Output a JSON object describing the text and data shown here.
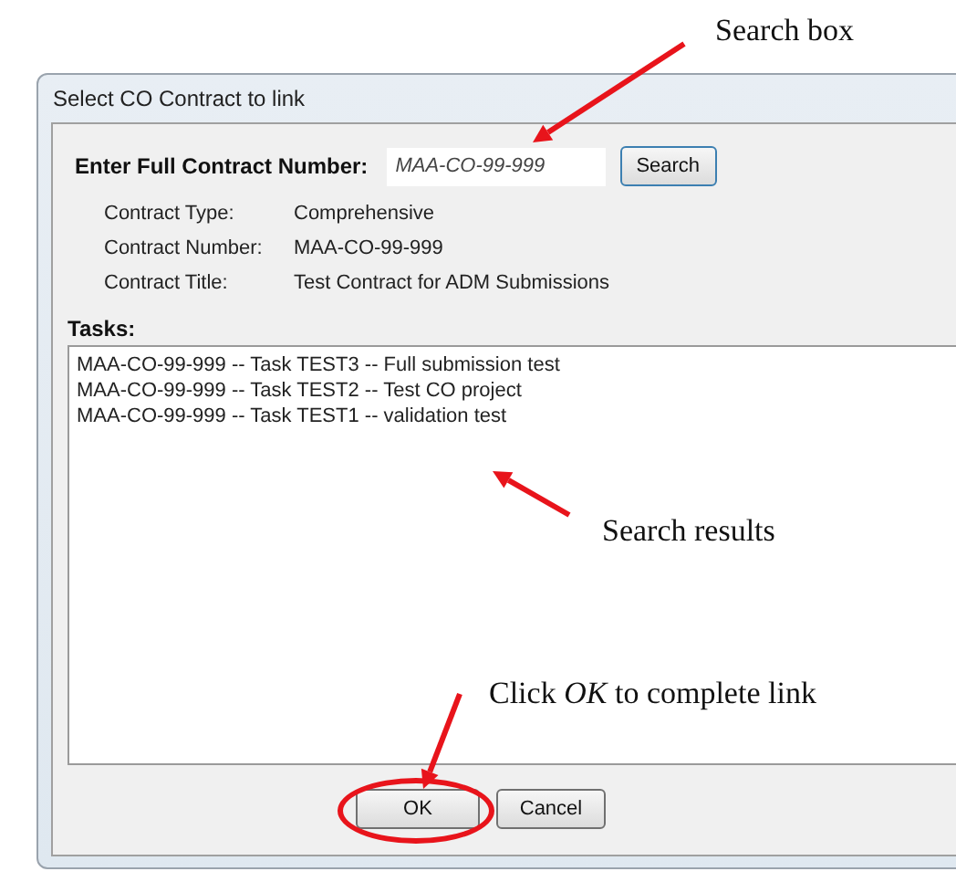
{
  "window": {
    "title": "Select CO Contract to link"
  },
  "search": {
    "label": "Enter Full Contract Number:",
    "value": "MAA-CO-99-999",
    "button": "Search"
  },
  "details": [
    {
      "label": "Contract Type:",
      "value": "Comprehensive"
    },
    {
      "label": "Contract Number:",
      "value": "MAA-CO-99-999"
    },
    {
      "label": "Contract Title:",
      "value": "Test Contract for ADM Submissions"
    }
  ],
  "tasks": {
    "label": "Tasks:",
    "items": [
      {
        "text": "MAA-CO-99-999 -- Task TEST3 -- Full submission test",
        "selected": false
      },
      {
        "text": "MAA-CO-99-999 -- Task TEST2 -- Test CO project",
        "selected": false
      },
      {
        "text": "MAA-CO-99-999 -- Task TEST1 -- validation test",
        "selected": false
      }
    ]
  },
  "buttons": [
    {
      "label": "OK",
      "circled": true
    },
    {
      "label": "Cancel",
      "circled": false
    }
  ],
  "annotations": [
    {
      "kind": "callout",
      "text": "Search box"
    },
    {
      "kind": "callout",
      "text": "Search results"
    },
    {
      "kind": "callout",
      "text": "Click *OK* to complete link"
    }
  ]
}
